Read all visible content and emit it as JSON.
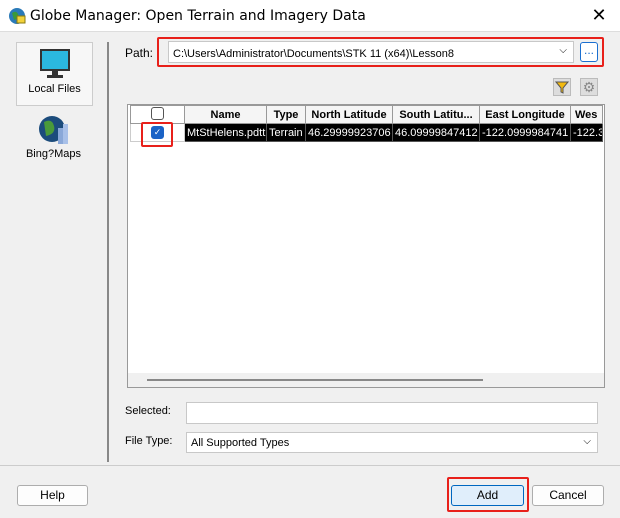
{
  "window": {
    "title": "Globe Manager: Open Terrain and Imagery Data",
    "close": "✕"
  },
  "sidebar": {
    "items": [
      {
        "label": "Local Files",
        "icon": "monitor-icon"
      },
      {
        "label": "Bing?Maps",
        "icon": "globe-city-icon"
      }
    ]
  },
  "path": {
    "label": "Path:",
    "value": "C:\\Users\\Administrator\\Documents\\STK 11 (x64)\\Lesson8",
    "browse": "..."
  },
  "table": {
    "columns": [
      "Name",
      "Type",
      "North Latitude",
      "South Latitu...",
      "East Longitude",
      "Wes"
    ],
    "rows": [
      {
        "checked": true,
        "cells": [
          "MtStHelens.pdtt",
          "Terrain",
          "46.29999923706",
          "46.09999847412",
          "-122.0999984741",
          "-122.3"
        ]
      }
    ]
  },
  "selected": {
    "label": "Selected:",
    "value": ""
  },
  "file_type": {
    "label": "File Type:",
    "value": "All Supported Types"
  },
  "buttons": {
    "help": "Help",
    "add": "Add",
    "cancel": "Cancel"
  }
}
